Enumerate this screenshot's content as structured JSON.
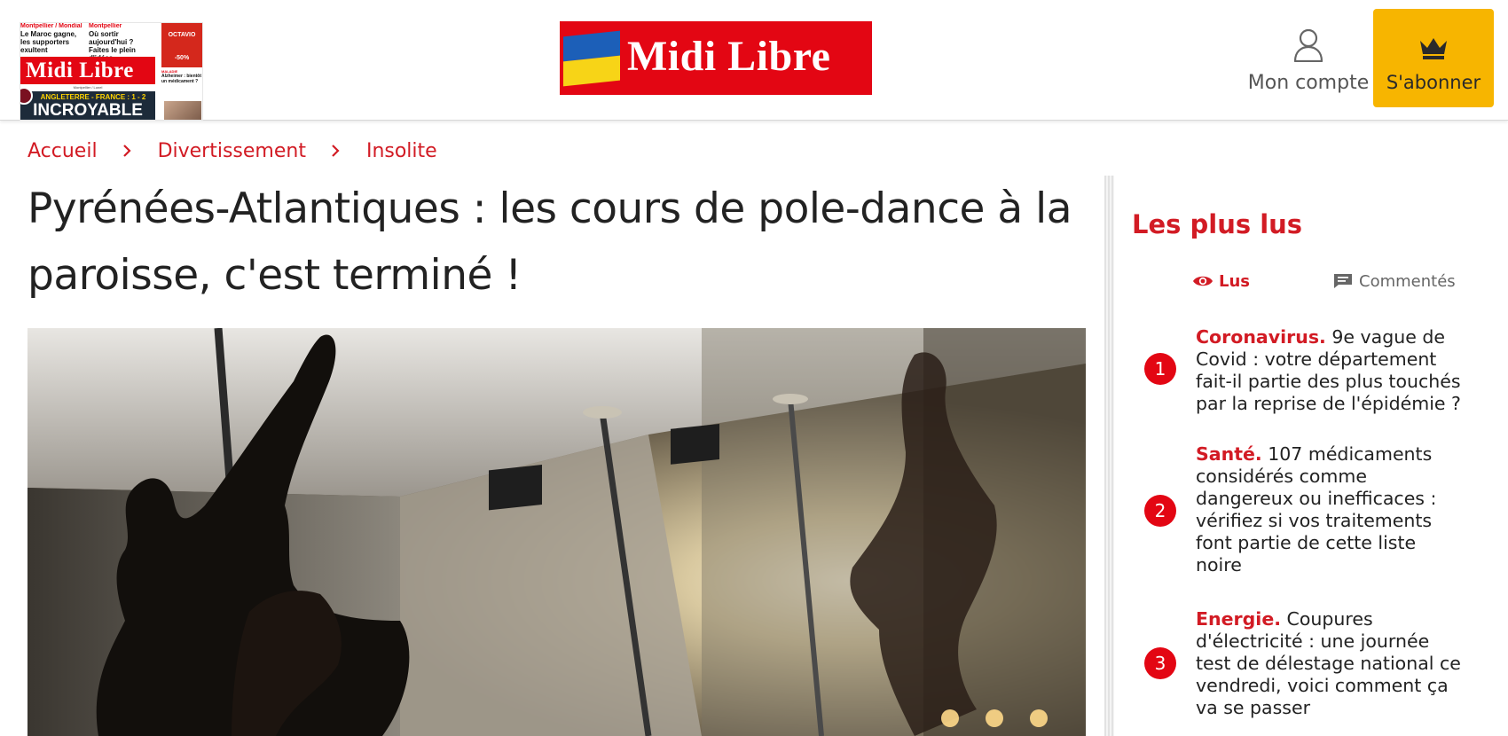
{
  "header": {
    "newspaper_thumb": {
      "kicker1": "Montpellier / Mondial",
      "headline1": "Le Maroc gagne, les supporters exultent",
      "kicker2": "Montpellier",
      "headline2": "Où sortir aujourd'hui ? Faites le plein d'idées",
      "masthead": "Midi Libre",
      "edition": "Montpellier / Lunel",
      "band_top": "ANGLETERRE - FRANCE : 1 - 2",
      "band_main": "INCROYABLE !!!",
      "ad_title": "OCTAVIO",
      "ad_price": "-50%",
      "side_kicker": "MALADIE",
      "side_headline": "Alzheimer : bientôt un médicament ?"
    },
    "logo_text": "Midi Libre",
    "account_label": "Mon compte",
    "subscribe_label": "S'abonner"
  },
  "breadcrumb": [
    "Accueil",
    "Divertissement",
    "Insolite"
  ],
  "article": {
    "title": "Pyrénées-Atlantiques : les cours de pole-dance à la paroisse, c'est terminé !"
  },
  "sidebar": {
    "title": "Les plus lus",
    "tabs": {
      "read": "Lus",
      "commented": "Commentés"
    },
    "items": [
      {
        "num": "1",
        "keyword": "Coronavirus.",
        "text": " 9e vague de Covid : votre département fait-il partie des plus touchés par la reprise de l'épidémie ?"
      },
      {
        "num": "2",
        "keyword": "Santé.",
        "text": " 107 médicaments considérés comme dangereux ou inefficaces : vérifiez si vos traitements font partie de cette liste noire"
      },
      {
        "num": "3",
        "keyword": "Energie.",
        "text": " Coupures d'électricité : une journée test de délestage national ce vendredi, voici comment ça va se passer"
      }
    ]
  },
  "colors": {
    "brand_red": "#e30613",
    "link_red": "#d21b24",
    "subscribe_yellow": "#f7b500"
  },
  "icons": [
    "user-icon",
    "crown-icon",
    "chevron-right-icon",
    "eye-icon",
    "comment-icon"
  ]
}
